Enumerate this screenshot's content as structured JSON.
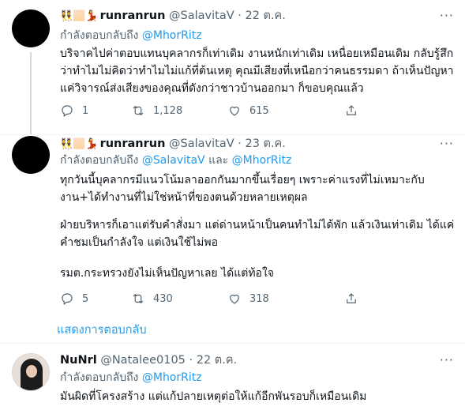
{
  "tweets": [
    {
      "emoji": "👯🏻💃",
      "name": "runranrun",
      "handle": "@SalavitaV",
      "dot": "·",
      "time": "22 ต.ค.",
      "replying_prefix": "กำลังตอบกลับถึง ",
      "replying_mentions": "@MhorRitz",
      "text": "บริจาคไปค่าตอบแทนบุคลากรก็เท่าเดิม งานหนักเท่าเดิม เหนื่อยเหมือนเดิม กลับรู้สึกว่าทำไมไม่คิดว่าทำไมไม่แก้ที่ต้นเหตุ คุณมีเสียงที่เหนือกว่าคนธรรมดา ถ้าเห็นปัญหาแค่วิจารณ์ส่งเสียงของคุณที่ดังกว่าชาวบ้านออกมา ก็ขอบคุณแล้ว",
      "replies": "1",
      "retweets": "1,128",
      "likes": "615"
    },
    {
      "emoji": "👯🏻💃",
      "name": "runranrun",
      "handle": "@SalavitaV",
      "dot": "·",
      "time": "23 ต.ค.",
      "replying_prefix": "กำลังตอบกลับถึง ",
      "replying_mentions": "@SalavitaV",
      "replying_and": " และ ",
      "replying_mentions2": "@MhorRitz",
      "para1": "ทุกวันนี้บุคลากรมีแนวโน้มลาออกกันมากขึ้นเรื่อยๆ เพราะค่าแรงที่ไม่เหมาะกับงาน+ได้ทำงานที่ไม่ใช่หน้าที่ของตนด้วยหลายเหตุผล",
      "para2": "ฝ่ายบริหารก็เอาแต่รับคำสั่งมา แต่ด่านหน้าเป็นคนทำไม่ได้พัก แล้วเงินเท่าเดิม ได้แค่คำชมเป็นกำลังใจ แต่เงินใช้ไม่พอ",
      "para3": "รมต.กระทรวงยังไม่เห็นปัญหาเลย ได้แต่ท้อใจ",
      "replies": "5",
      "retweets": "430",
      "likes": "318"
    },
    {
      "name": "NuNrl",
      "handle": "@Natalee0105",
      "dot": "·",
      "time": "22 ต.ค.",
      "replying_prefix": "กำลังตอบกลับถึง ",
      "replying_mentions": "@MhorRitz",
      "text": "มันผิดที่โครงสร้าง แต่แก้ปลายเหตุต่อให้แก้อีกพันรอบก็เหมือนเดิม"
    }
  ],
  "show_replies": "แสดงการตอบกลับ",
  "more_glyph": "···",
  "icons": [
    "reply-icon",
    "retweet-icon",
    "like-icon",
    "share-icon",
    "more-icon"
  ],
  "colors": {
    "link": "#1d9bf0",
    "muted": "#536471",
    "text": "#0f1419",
    "line": "#cfd9de"
  }
}
